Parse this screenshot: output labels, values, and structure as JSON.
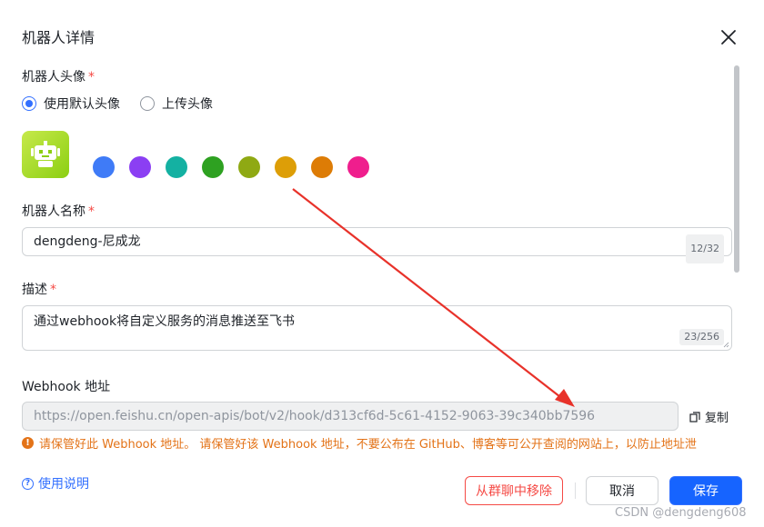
{
  "dialog": {
    "title": "机器人详情"
  },
  "avatar_section": {
    "label": "机器人头像",
    "required_mark": "*",
    "options": [
      {
        "label": "使用默认头像",
        "checked": true
      },
      {
        "label": "上传头像",
        "checked": false
      }
    ],
    "current_icon": "robot-icon",
    "colors": [
      "#3f7bf7",
      "#8b3ff3",
      "#14b1a2",
      "#2ea121",
      "#8fa913",
      "#dd9e07",
      "#dd7c06",
      "#ef1e8d"
    ]
  },
  "name_section": {
    "label": "机器人名称",
    "required_mark": "*",
    "value": "dengdeng-尼成龙",
    "counter": "12/32"
  },
  "desc_section": {
    "label": "描述",
    "required_mark": "*",
    "value": "通过webhook将自定义服务的消息推送至飞书",
    "counter": "23/256"
  },
  "webhook_section": {
    "label": "Webhook 地址",
    "value": "https://open.feishu.cn/open-apis/bot/v2/hook/d313cf6d-5c61-4152-9063-39c340bb7596",
    "copy_label": "复制",
    "warning": "请保管好此 Webhook 地址。 请保管好该 Webhook 地址，不要公布在 GitHub、博客等可公开查阅的网站上，以防止地址泄"
  },
  "footer": {
    "help_label": "使用说明",
    "remove_label": "从群聊中移除",
    "cancel_label": "取消",
    "save_label": "保存"
  },
  "watermark": "CSDN @dengdeng608",
  "colors": {
    "primary": "#1664ff",
    "danger": "#f54a45",
    "warning": "#e37318",
    "arrow": "#e8322a"
  }
}
